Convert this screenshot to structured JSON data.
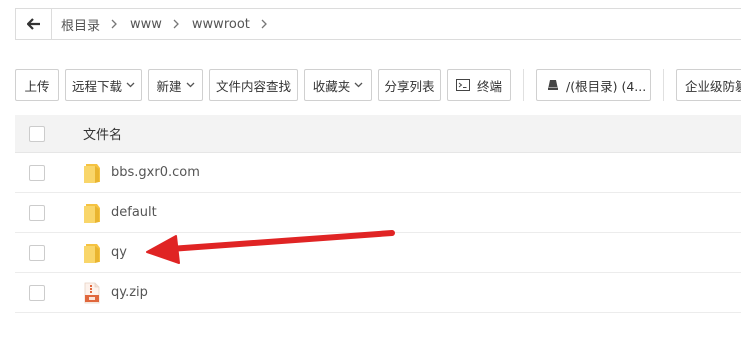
{
  "breadcrumb": {
    "items": [
      "根目录",
      "www",
      "wwwroot"
    ]
  },
  "toolbar": {
    "upload": "上传",
    "remote_download": "远程下载",
    "new": "新建",
    "content_search": "文件内容查找",
    "favorites": "收藏夹",
    "share_list": "分享列表",
    "terminal": "终端",
    "disk": "/(根目录) (4...",
    "firewall": "企业级防篡改"
  },
  "table": {
    "header_name": "文件名",
    "rows": [
      {
        "name": "bbs.gxr0.com",
        "type": "folder"
      },
      {
        "name": "default",
        "type": "folder"
      },
      {
        "name": "qy",
        "type": "folder"
      },
      {
        "name": "qy.zip",
        "type": "zip"
      }
    ]
  },
  "colors": {
    "folder": "#f7c948",
    "annotation_arrow": "#e02424",
    "header_bg": "#f3f3f3",
    "border": "#dcdcdc"
  },
  "icons": {
    "back": "arrow-left-icon",
    "crumb_separator": "chevron-right-icon",
    "dropdown": "chevron-down-icon",
    "terminal": "terminal-icon",
    "disk": "disk-icon",
    "folder": "folder-icon",
    "zip": "zip-file-icon"
  }
}
